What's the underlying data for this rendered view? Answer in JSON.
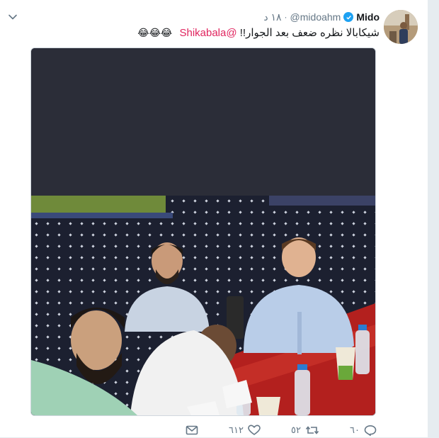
{
  "tweet": {
    "author_name": "Mido",
    "handle": "@midoahm",
    "separator": "·",
    "timestamp": "١٨ د",
    "mention": "@Shikabala",
    "text": "شيكابالا نظره ضعف بعد الجوار!!",
    "emojis": "😂😂😂"
  },
  "actions": {
    "reply_count": "٦٠",
    "retweet_count": "٥٢",
    "like_count": "٦١٢"
  },
  "icons": {
    "verified": "verified-badge-icon",
    "caret": "chevron-down-icon",
    "reply": "reply-icon",
    "retweet": "retweet-icon",
    "like": "heart-icon",
    "message": "envelope-icon"
  },
  "colors": {
    "link": "#1da1f2",
    "mention": "#e0245e",
    "muted": "#657786",
    "text": "#14171a"
  }
}
